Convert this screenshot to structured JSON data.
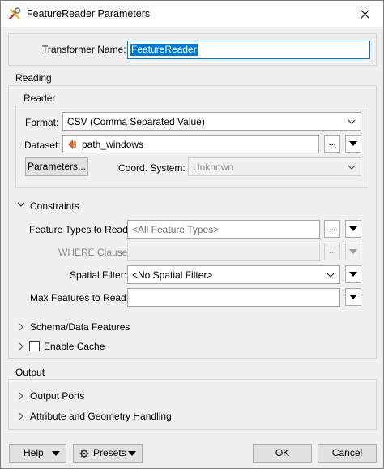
{
  "window": {
    "title": "FeatureReader Parameters",
    "app_icon": "fme-wrench-icon",
    "close_icon": "close-icon"
  },
  "transformer": {
    "label": "Transformer Name:",
    "value": "FeatureReader"
  },
  "reading": {
    "title": "Reading",
    "reader": {
      "title": "Reader",
      "format_label": "Format:",
      "format_value": "CSV (Comma Separated Value)",
      "dataset_label": "Dataset:",
      "dataset_value": "path_windows",
      "dataset_icon": "attribute-value-icon",
      "browse_label": "...",
      "parameters_button": "Parameters...",
      "coord_label": "Coord. System:",
      "coord_value": "Unknown"
    },
    "constraints": {
      "title": "Constraints",
      "expanded": true,
      "feature_types_label": "Feature Types to Read:",
      "feature_types_placeholder": "<All Feature Types>",
      "where_label": "WHERE Clause:",
      "where_value": "",
      "spatial_filter_label": "Spatial Filter:",
      "spatial_filter_value": "<No Spatial Filter>",
      "max_features_label": "Max Features to Read:",
      "max_features_value": ""
    },
    "schema_title": "Schema/Data Features",
    "enable_cache_label": "Enable Cache",
    "enable_cache_checked": false
  },
  "output": {
    "title": "Output",
    "ports_title": "Output Ports",
    "attr_title": "Attribute and Geometry Handling"
  },
  "buttons": {
    "help": "Help",
    "presets": "Presets",
    "ok": "OK",
    "cancel": "Cancel"
  },
  "colors": {
    "accent": "#0078d7",
    "background": "#f0f0f0"
  }
}
